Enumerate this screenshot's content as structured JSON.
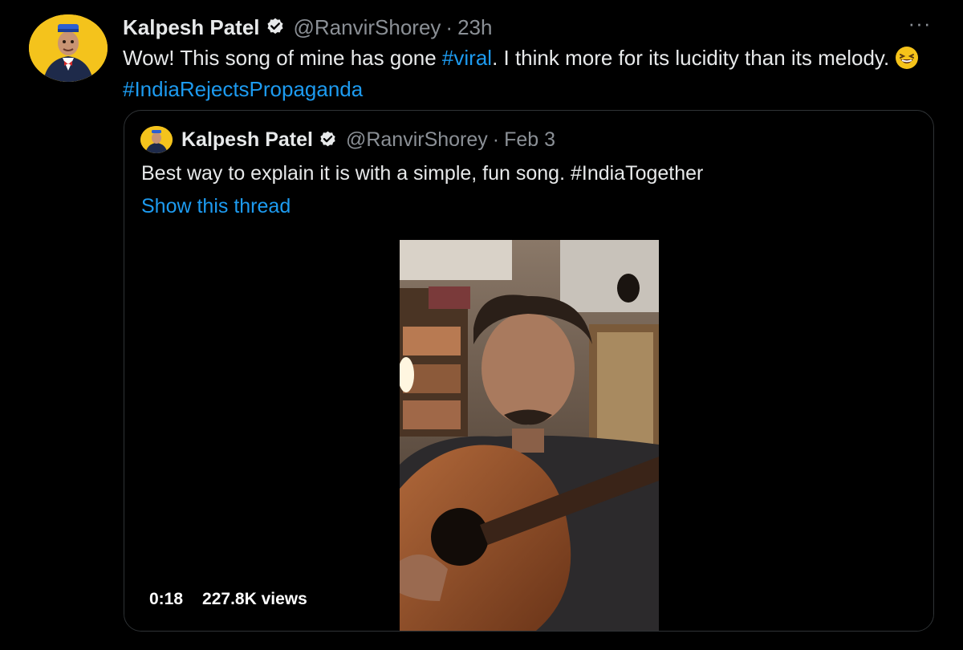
{
  "tweet": {
    "author_name": "Kalpesh Patel",
    "handle": "@RanvirShorey",
    "separator": "·",
    "time": "23h",
    "more_label": "···",
    "text_part1": "Wow! This song of mine has gone ",
    "hashtag_viral": "#viral",
    "text_part2": ". I think more for its lucidity than its melody. ",
    "hashtag_end": "#IndiaRejectsPropaganda",
    "emoji": "laughing-face"
  },
  "quote": {
    "author_name": "Kalpesh Patel",
    "handle": "@RanvirShorey",
    "separator": "·",
    "date": "Feb 3",
    "text": "Best way to explain it is with a simple, fun song. #IndiaTogether",
    "show_thread": "Show this thread",
    "video": {
      "duration": "0:18",
      "views": "227.8K views"
    }
  },
  "colors": {
    "background": "#000000",
    "text": "#e7e9ea",
    "muted": "#8b9096",
    "link": "#1d9bf0",
    "border": "#2f3336"
  },
  "icons": [
    "verified-badge-icon",
    "more-options-icon",
    "laughing-emoji-icon"
  ]
}
